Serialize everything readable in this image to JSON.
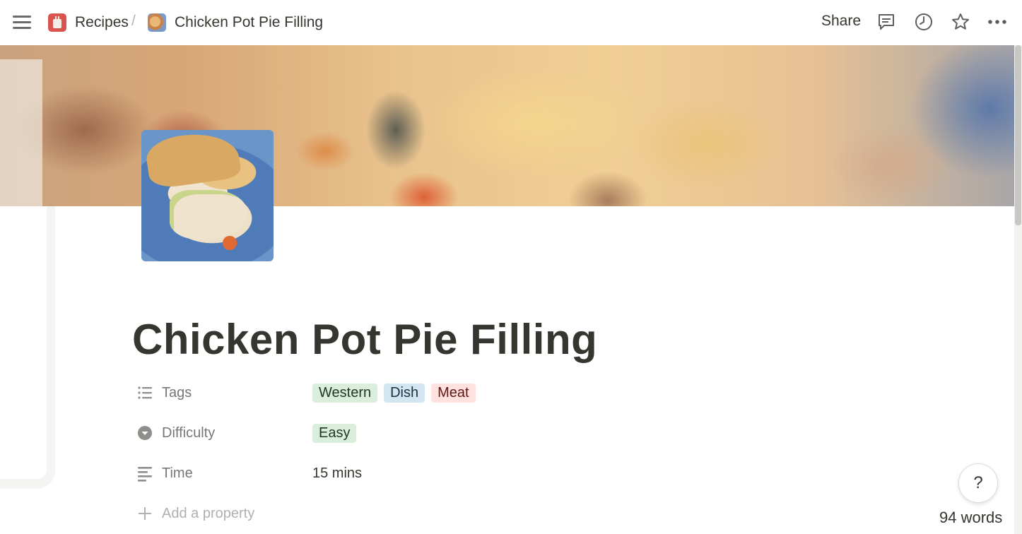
{
  "topbar": {
    "breadcrumbs": [
      {
        "label": "Recipes",
        "icon": "recipes-jar-icon"
      },
      {
        "label": "Chicken Pot Pie Filling",
        "icon": "pot-pie-icon"
      }
    ],
    "separator": "/",
    "share_label": "Share",
    "icons": [
      "menu-icon",
      "comment-icon",
      "history-icon",
      "star-icon",
      "more-icon"
    ]
  },
  "page": {
    "title": "Chicken Pot Pie Filling",
    "properties": [
      {
        "label": "Tags",
        "icon": "list-icon",
        "values": [
          {
            "text": "Western",
            "color": "#dbeddb"
          },
          {
            "text": "Dish",
            "color": "#d3e5ef"
          },
          {
            "text": "Meat",
            "color": "#ffe2dd"
          }
        ]
      },
      {
        "label": "Difficulty",
        "icon": "select-icon",
        "values": [
          {
            "text": "Easy",
            "color": "#dbeddb"
          }
        ]
      },
      {
        "label": "Time",
        "icon": "text-icon",
        "value": "15 mins"
      }
    ],
    "add_property_label": "Add a property"
  },
  "help": {
    "label": "?"
  },
  "word_count": "94 words"
}
